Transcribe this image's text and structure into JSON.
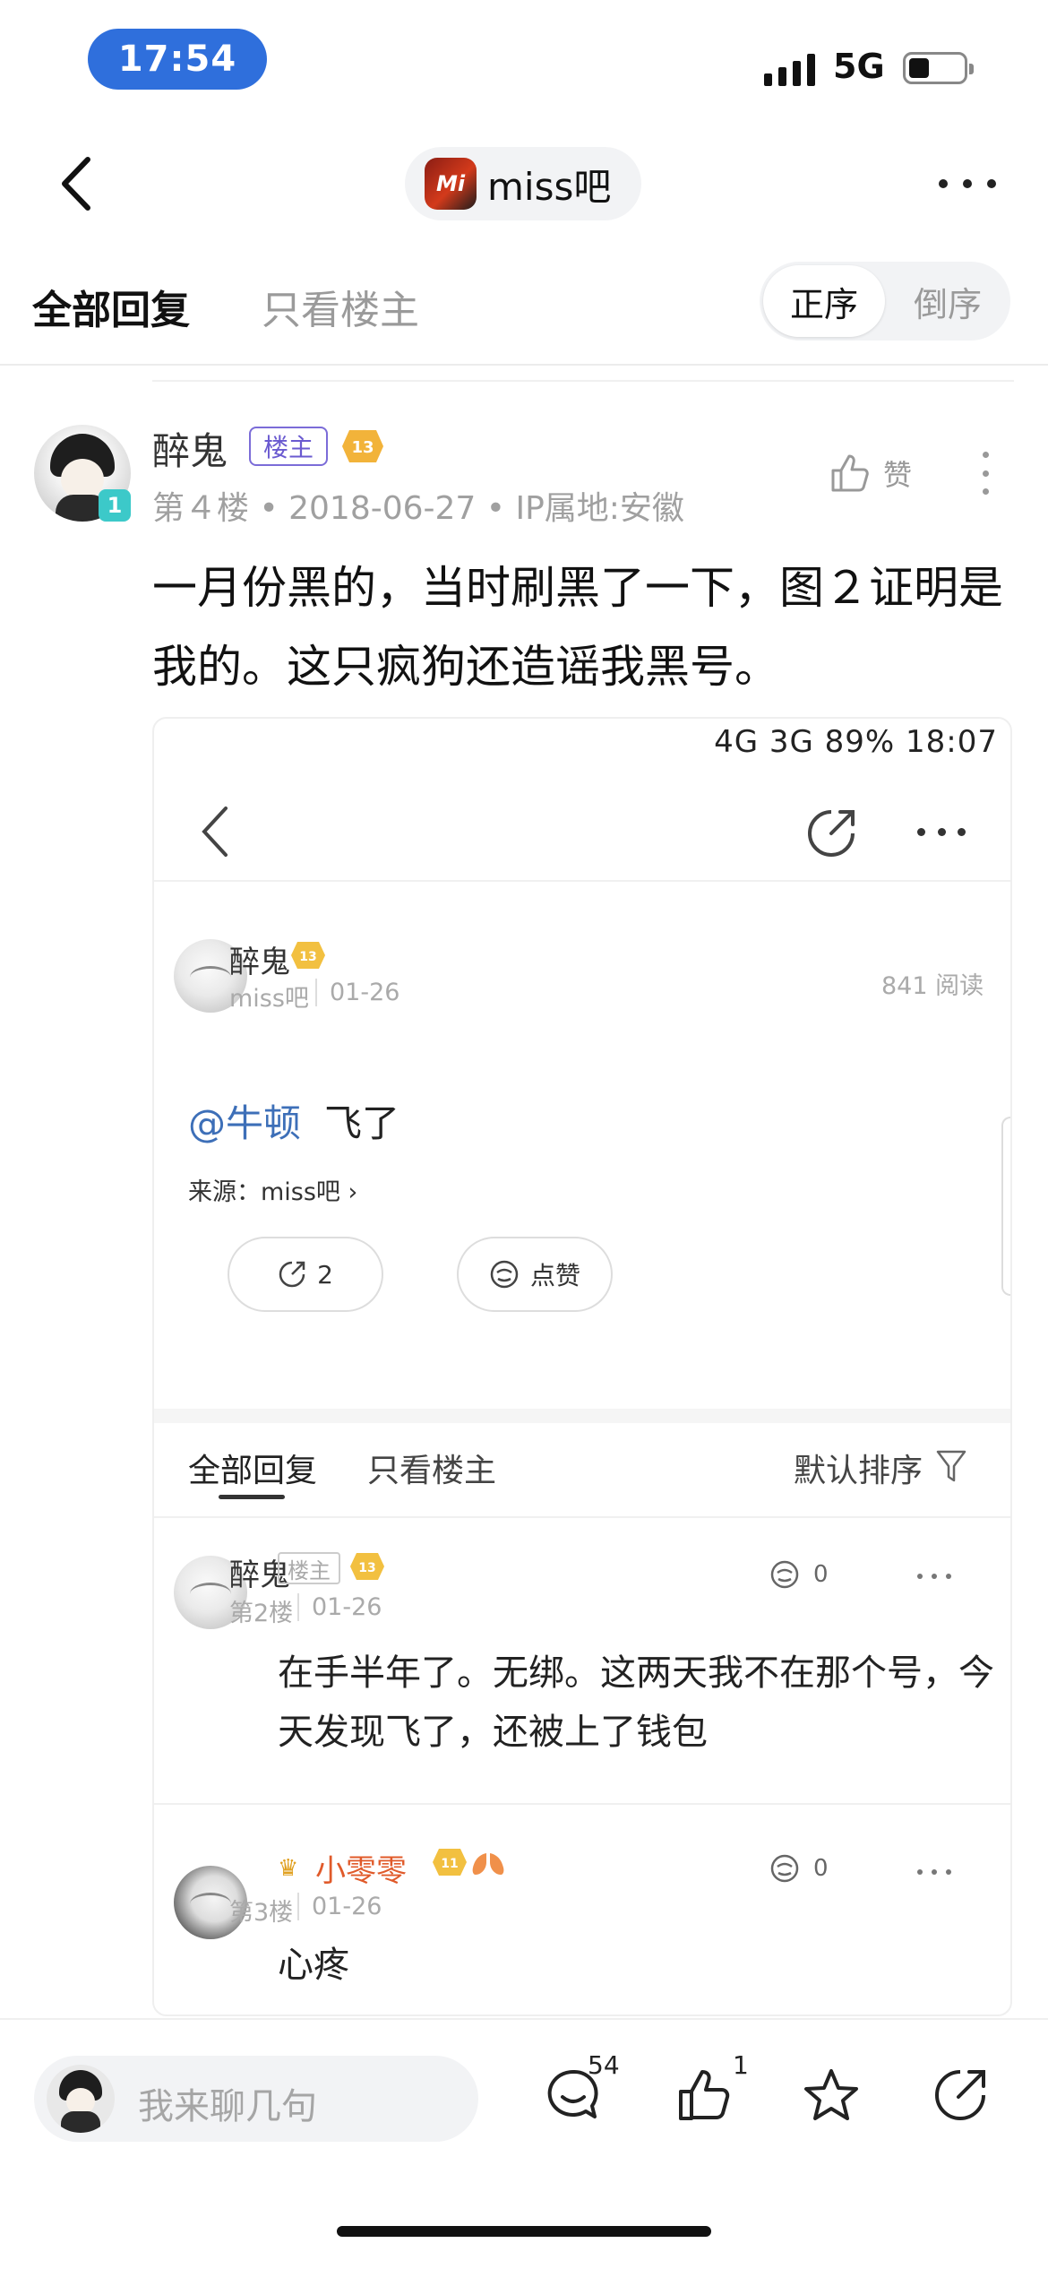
{
  "status_bar": {
    "time": "17:54",
    "network": "5G"
  },
  "nav": {
    "forum_name": "miss吧",
    "forum_logo_text": "Mi"
  },
  "tabs": {
    "all": "全部回复",
    "host_only": "只看楼主",
    "sort_asc": "正序",
    "sort_desc": "倒序"
  },
  "post": {
    "username": "醉鬼",
    "host_badge": "楼主",
    "level": "13",
    "user_level_badge": "1",
    "meta": "第４楼 • 2018-06-27 • IP属地:安徽",
    "like_label": "赞",
    "text": "一月份黑的，当时刷黑了一下，图２证明是我的。这只疯狗还造谣我黑号。"
  },
  "screenshot": {
    "status_text": "4G 3G 89% 18:07",
    "op": {
      "name": "醉鬼",
      "level": "13",
      "forum": "miss吧",
      "date": "01-26",
      "reads": "841 阅读"
    },
    "mention": "@牛顿",
    "mention_tail": "飞了",
    "source": "来源：miss吧 ›",
    "share_count": "2",
    "like_button": "点赞",
    "tabs": {
      "all": "全部回复",
      "host_only": "只看楼主",
      "sort": "默认排序"
    },
    "replies": [
      {
        "name": "醉鬼",
        "badge": "楼主",
        "level": "13",
        "floor": "第2楼",
        "date": "01-26",
        "likes": "0",
        "text": "在手半年了。无绑。这两天我不在那个号，今天发现飞了，还被上了钱包"
      },
      {
        "name": "小零零",
        "level": "11",
        "floor": "第3楼",
        "date": "01-26",
        "likes": "0",
        "text": "心疼"
      }
    ]
  },
  "bottom_bar": {
    "placeholder": "我来聊几句",
    "comment_count": "54",
    "like_count": "1"
  },
  "colors": {
    "accent": "#2f6fdc",
    "host_badge": "#6a5ad0",
    "mention": "#3d6fb8",
    "vip_name": "#e05a2a"
  }
}
